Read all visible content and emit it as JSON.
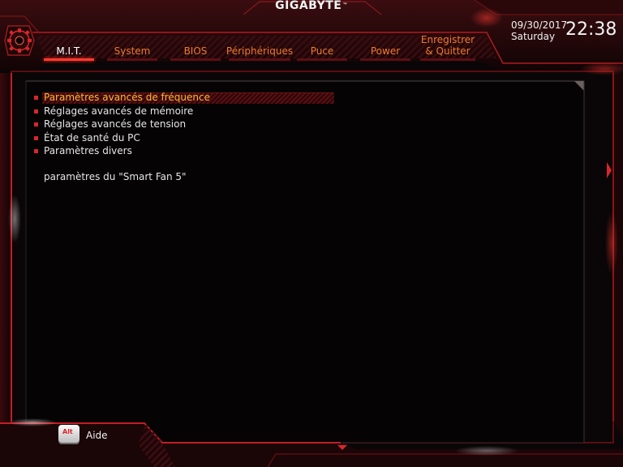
{
  "brand": "GIGABYTE",
  "brand_mark": "™",
  "datetime": {
    "date": "09/30/2017",
    "day": "Saturday",
    "time": "22:38"
  },
  "tabs": [
    {
      "label": "M.I.T.",
      "active": true
    },
    {
      "label": "System"
    },
    {
      "label": "BIOS"
    },
    {
      "label": "Périphériques"
    },
    {
      "label": "Puce"
    },
    {
      "label": "Power"
    },
    {
      "label": "Enregistrer\n& Quitter"
    }
  ],
  "menu": [
    {
      "label": "Paramètres avancés de fréquence",
      "selected": true
    },
    {
      "label": "Réglages avancés de mémoire"
    },
    {
      "label": "Réglages avancés de tension"
    },
    {
      "label": "État de santé du PC"
    },
    {
      "label": "Paramètres divers"
    }
  ],
  "description": "paramètres du \"Smart Fan 5\"",
  "footer": {
    "key_label": "Alt",
    "help_label": "Aide"
  },
  "colors": {
    "accent": "#d8262a",
    "tab_text": "#ee7a2b",
    "selected_text": "#ffb833",
    "background": "#0a0708"
  }
}
